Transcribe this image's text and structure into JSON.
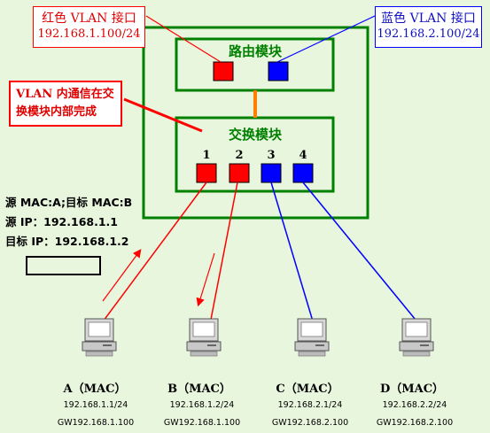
{
  "red_vlan_callout": {
    "title": "红色 VLAN 接口",
    "subnet": "192.168.1.100/24"
  },
  "blue_vlan_callout": {
    "title": "蓝色 VLAN 接口",
    "subnet": "192.168.2.100/24"
  },
  "note_callout": {
    "line1": "VLAN 内通信在交",
    "line2": "换模块内部完成"
  },
  "router_module": {
    "title": "路由模块"
  },
  "switch_module": {
    "title": "交换模块",
    "ports": [
      "1",
      "2",
      "3",
      "4"
    ]
  },
  "packet_info": {
    "mac": "源 MAC:A;目标 MAC:B",
    "src_ip": "源 IP：192.168.1.1",
    "dst_ip": "目标 IP：192.168.1.2"
  },
  "computers": [
    {
      "label": "A（MAC）",
      "ip": "192.168.1.1/24",
      "gw": "GW192.168.1.100"
    },
    {
      "label": "B（MAC）",
      "ip": "192.168.1.2/24",
      "gw": "GW192.168.1.100"
    },
    {
      "label": "C（MAC）",
      "ip": "192.168.2.1/24",
      "gw": "GW192.168.2.100"
    },
    {
      "label": "D（MAC）",
      "ip": "192.168.2.2/24",
      "gw": "GW192.168.2.100"
    }
  ],
  "colors": {
    "red": "#ff0000",
    "blue": "#0000ff",
    "green": "#008000",
    "orange": "#ff8000"
  }
}
